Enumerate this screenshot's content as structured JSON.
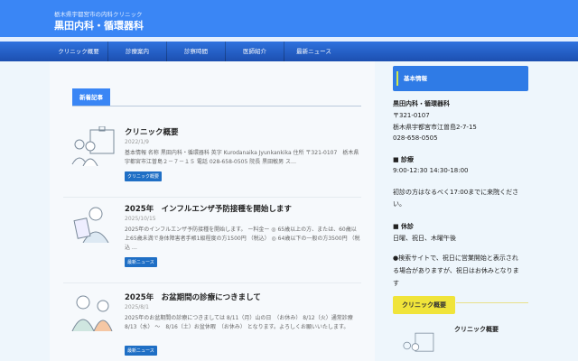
{
  "header": {
    "tagline": "栃木県宇都宮市の内科クリニック",
    "site_title": "黒田内科・循環器科"
  },
  "nav": [
    "クリニック概要",
    "診療案内",
    "診察時間",
    "医師紹介",
    "最新ニュース"
  ],
  "main": {
    "section_title": "新着記事",
    "posts": [
      {
        "title": "クリニック概要",
        "date": "2022/1/9",
        "excerpt": "基本情報 名称 黒田内科・循環器科 英字 Kurodanaika Jyunkankika 住所 〒321-0107　栃木県宇都宮市江曽島２－７－１５ 電話 028-658-0505 院長 黒田敏男 ス…",
        "category": "クリニック概要"
      },
      {
        "title": "2025年　インフルエンザ予防接種を開始します",
        "date": "2025/10/15",
        "excerpt": "2025年のインフルエンザ予防接種を開始します。 ー料金ー ◎ 65歳以上の方、または、60歳以上65歳未満で身体障害者手帳1級程度の方1500円 （税込） ◎ 64歳以下の一般の方3500円 （税込 …",
        "category": "最新ニュース"
      },
      {
        "title": "2025年　お盆期間の診療につきまして",
        "date": "2025/8/1",
        "excerpt": "2025年のお盆期間の診療につきましては 8/11（月）山の日　（お休み） 8/12（火）通常診療8/13（水） ～　8/16（土）お盆休暇　（お休み） となります。よろしくお願いいたします。",
        "category": "最新ニュース"
      }
    ]
  },
  "sidebar": {
    "heading": "基本情報",
    "name": "黒田内科・循環器科",
    "postal": "〒321-0107",
    "address": "栃木県宇都宮市江曽島2-7-15",
    "phone": "028-658-0505",
    "hours_title": "■ 診療",
    "hours": "9:00-12:30  14:30-18:00",
    "note1a": "初診の方はなるべく17:00までに来院くださ",
    "note1b": "い。",
    "closed_title": "■ 休診",
    "closed": "日曜、祝日、木曜午後",
    "note2a": "●検索サイトで、祝日に営業開始と表示され",
    "note2b": "る場合がありますが、祝日はお休みとなりま",
    "note2c": "す",
    "widget_title": "クリニック概要",
    "widget_post": "クリニック概要"
  }
}
